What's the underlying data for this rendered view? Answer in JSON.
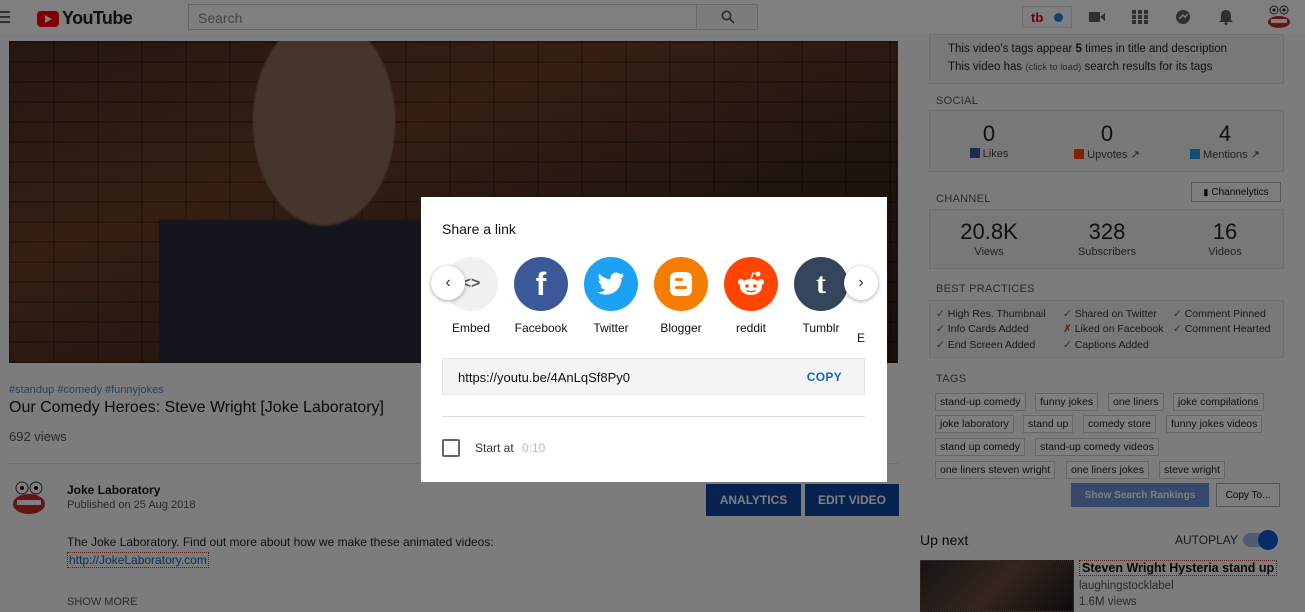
{
  "header": {
    "logo_text": "YouTube",
    "search_placeholder": "Search",
    "tb_badge": "tb"
  },
  "video": {
    "hashtags": "#standup #comedy #funnyjokes",
    "title": "Our Comedy Heroes: Steve Wright [Joke Laboratory]",
    "views": "692 views",
    "channel_name": "Joke Laboratory",
    "published": "Published on 25 Aug 2018",
    "analytics_label": "ANALYTICS",
    "edit_label": "EDIT VIDEO",
    "description": "The Joke Laboratory. Find out more about how we make these animated videos:",
    "description_link": "http://JokeLaboratory.com",
    "show_more": "SHOW MORE"
  },
  "panel": {
    "tags_line1_a": "This video's tags appear ",
    "tags_line1_count": "5",
    "tags_line1_b": " times in title and description",
    "tags_line2_a": "This video has ",
    "tags_line2_click": "(click to load)",
    "tags_line2_b": " search results for its tags",
    "social_heading": "SOCIAL",
    "social": [
      {
        "num": "0",
        "label": "Likes"
      },
      {
        "num": "0",
        "label": "Upvotes"
      },
      {
        "num": "4",
        "label": "Mentions"
      }
    ],
    "channel_heading": "CHANNEL",
    "channelytics_label": "Channelytics",
    "channel_stats": [
      {
        "num": "20.8K",
        "label": "Views"
      },
      {
        "num": "328",
        "label": "Subscribers"
      },
      {
        "num": "16",
        "label": "Videos"
      }
    ],
    "best_heading": "BEST PRACTICES",
    "best_practices": [
      {
        "text": "High Res. Thumbnail",
        "ok": true
      },
      {
        "text": "Info Cards Added",
        "ok": true
      },
      {
        "text": "End Screen Added",
        "ok": true
      },
      {
        "text": "Shared on Twitter",
        "ok": true
      },
      {
        "text": "Liked on Facebook",
        "ok": false
      },
      {
        "text": "Captions Added",
        "ok": true
      },
      {
        "text": "Comment Pinned",
        "ok": true
      },
      {
        "text": "Comment Hearted",
        "ok": true
      }
    ],
    "tags_heading": "TAGS",
    "tags": [
      "stand-up comedy",
      "funny jokes",
      "one liners",
      "joke compilations",
      "joke laboratory",
      "stand up",
      "comedy store",
      "funny jokes videos",
      "stand up comedy",
      "stand-up comedy videos",
      "one liners steven wright",
      "one liners jokes",
      "steve wright"
    ],
    "show_rankings": "Show Search Rankings",
    "copy_to": "Copy To..."
  },
  "upnext": {
    "heading": "Up next",
    "autoplay": "AUTOPLAY",
    "title": "Steven Wright Hysteria stand up",
    "channel": "laughingstocklabel",
    "views": "1.6M views"
  },
  "share": {
    "title": "Share a link",
    "items": [
      "Embed",
      "Facebook",
      "Twitter",
      "Blogger",
      "reddit",
      "Tumblr",
      "E"
    ],
    "url": "https://youtu.be/4AnLqSf8Py0",
    "copy": "COPY",
    "start_at": "Start at",
    "start_time": "0:10"
  },
  "colors": {
    "facebook": "#3b5998",
    "twitter": "#1da1f2",
    "blogger": "#f57d00",
    "reddit": "#ff4500",
    "tumblr": "#35465c",
    "accent": "#0d47a1"
  }
}
